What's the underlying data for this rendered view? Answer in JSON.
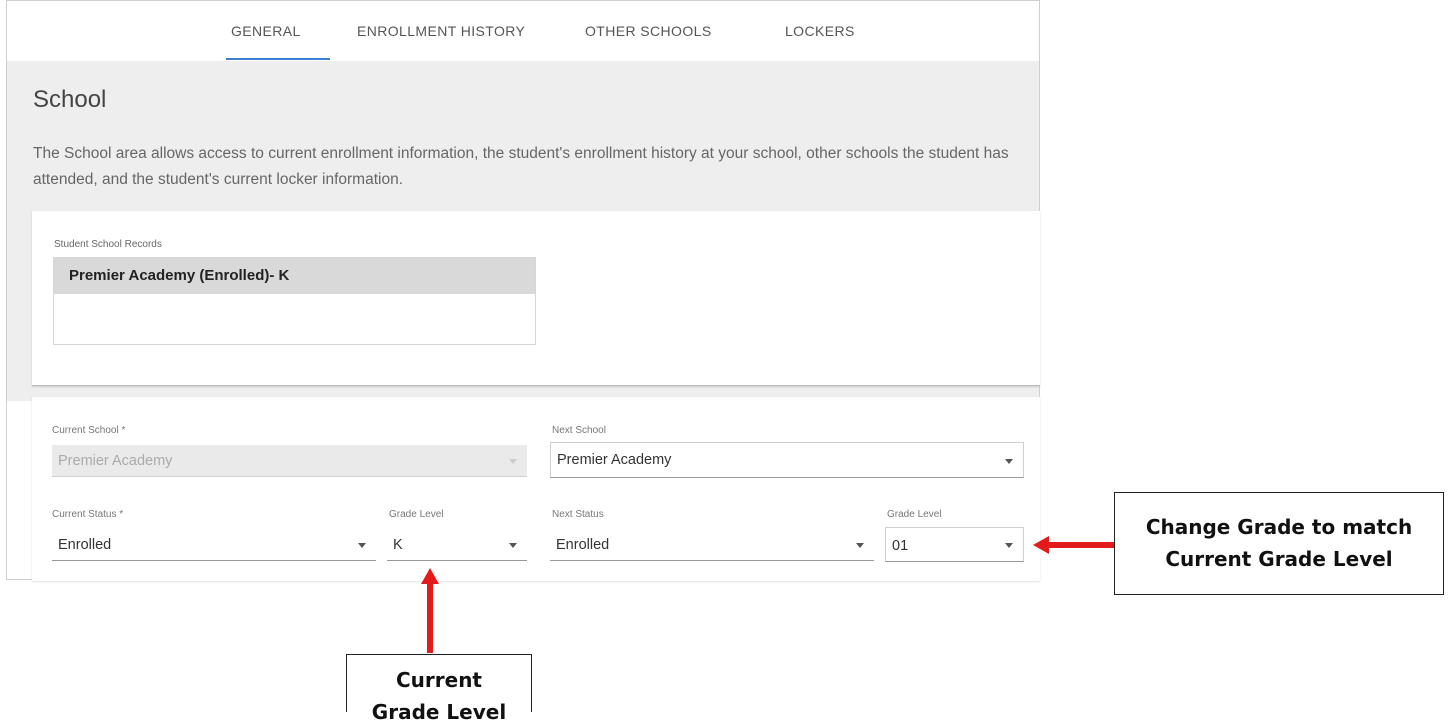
{
  "tabs": [
    {
      "label": "GENERAL",
      "active": true
    },
    {
      "label": "ENROLLMENT HISTORY"
    },
    {
      "label": "OTHER SCHOOLS"
    },
    {
      "label": "LOCKERS"
    }
  ],
  "header": {
    "title": "School",
    "description": "The School area allows access to current enrollment information, the student's enrollment history at your school, other schools the student has attended, and the student's current locker information."
  },
  "records": {
    "label": "Student School Records",
    "items": [
      "Premier Academy (Enrolled)- K"
    ]
  },
  "form": {
    "current_school_label": "Current School *",
    "current_school_value": "Premier Academy",
    "next_school_label": "Next School",
    "next_school_value": "Premier Academy",
    "current_status_label": "Current Status *",
    "current_status_value": "Enrolled",
    "current_grade_label": "Grade Level",
    "current_grade_value": "K",
    "next_status_label": "Next Status",
    "next_status_value": "Enrolled",
    "next_grade_label": "Grade Level",
    "next_grade_value": "01"
  },
  "annotations": {
    "change_grade_line1": "Change Grade to match",
    "change_grade_line2": "Current Grade Level",
    "current_grade_line1": "Current",
    "current_grade_line2": "Grade Level",
    "arrow_color": "#e31b1b"
  },
  "colors": {
    "accent": "#3d7fd0",
    "background_gray": "#eeeeee"
  }
}
